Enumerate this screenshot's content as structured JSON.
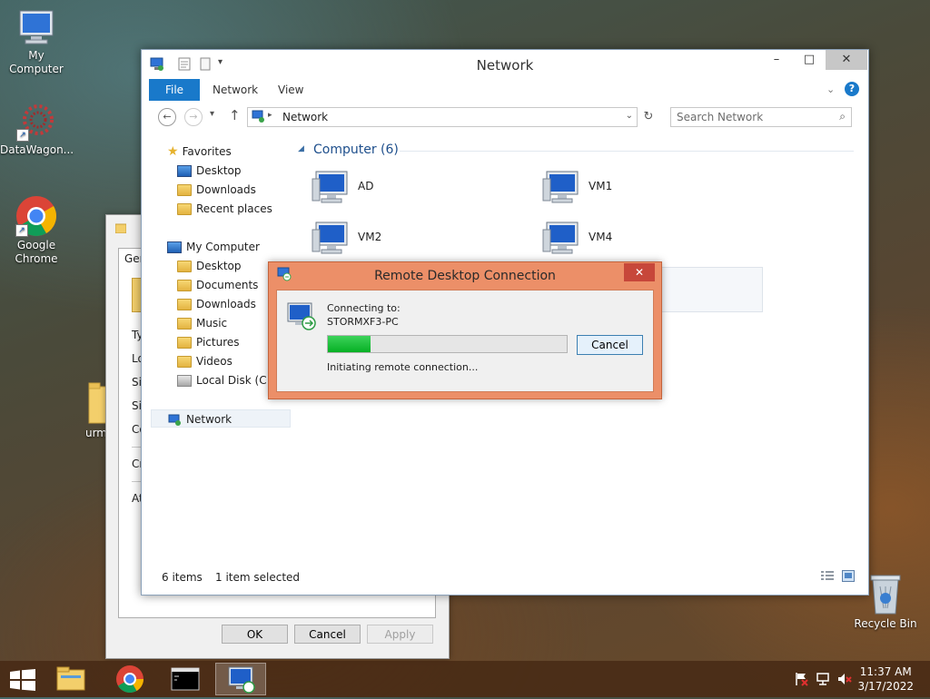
{
  "desktop": {
    "icons": [
      {
        "label": "My Computer"
      },
      {
        "label": "DataWagon..."
      },
      {
        "label": "Google Chrome"
      },
      {
        "label": "urm"
      },
      {
        "label": "Recycle Bin"
      }
    ]
  },
  "bg_window": {
    "tab_label": "Gen",
    "labels": [
      "Ty",
      "Lo",
      "Siz",
      "Siz",
      "Co",
      "Cr",
      "Att"
    ],
    "buttons": {
      "ok": "OK",
      "cancel": "Cancel",
      "apply": "Apply"
    }
  },
  "explorer": {
    "title": "Network",
    "ribbon": {
      "file": "File",
      "network": "Network",
      "view": "View"
    },
    "address": {
      "path": "Network"
    },
    "search": {
      "placeholder": "Search Network"
    },
    "nav": {
      "favorites": "Favorites",
      "favorites_items": [
        "Desktop",
        "Downloads",
        "Recent places"
      ],
      "my_computer": "My Computer",
      "my_computer_items": [
        "Desktop",
        "Documents",
        "Downloads",
        "Music",
        "Pictures",
        "Videos",
        "Local Disk (C:)"
      ],
      "network": "Network"
    },
    "group_header": "Computer (6)",
    "computers": [
      "AD",
      "VM1",
      "VM2",
      "VM4"
    ],
    "status": {
      "items": "6 items",
      "selected": "1 item selected"
    }
  },
  "rdc": {
    "title": "Remote Desktop Connection",
    "connecting_to": "Connecting to:",
    "host": "STORMXF3-PC",
    "progress_fraction": 0.18,
    "cancel": "Cancel",
    "status": "Initiating remote connection..."
  },
  "taskbar": {
    "time": "11:37 AM",
    "date": "3/17/2022"
  },
  "colors": {
    "accent_blue": "#1979ca",
    "rdc_frame": "#ec8f68",
    "progress_green": "#06b025"
  }
}
